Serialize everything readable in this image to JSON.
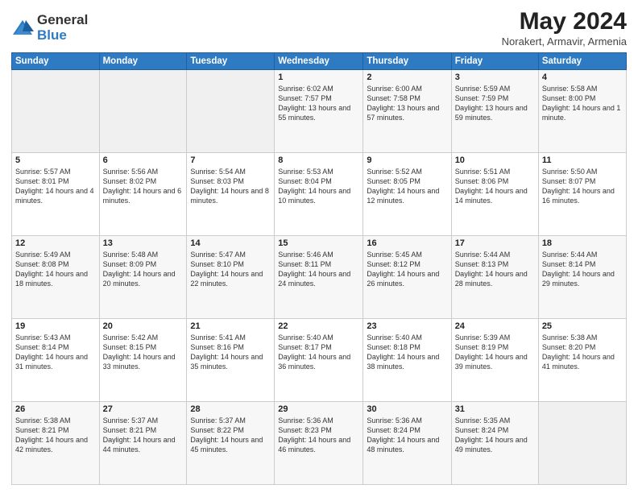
{
  "logo": {
    "general": "General",
    "blue": "Blue"
  },
  "title": "May 2024",
  "location": "Norakert, Armavir, Armenia",
  "headers": [
    "Sunday",
    "Monday",
    "Tuesday",
    "Wednesday",
    "Thursday",
    "Friday",
    "Saturday"
  ],
  "weeks": [
    [
      {
        "num": "",
        "detail": ""
      },
      {
        "num": "",
        "detail": ""
      },
      {
        "num": "",
        "detail": ""
      },
      {
        "num": "1",
        "detail": "Sunrise: 6:02 AM\nSunset: 7:57 PM\nDaylight: 13 hours\nand 55 minutes."
      },
      {
        "num": "2",
        "detail": "Sunrise: 6:00 AM\nSunset: 7:58 PM\nDaylight: 13 hours\nand 57 minutes."
      },
      {
        "num": "3",
        "detail": "Sunrise: 5:59 AM\nSunset: 7:59 PM\nDaylight: 13 hours\nand 59 minutes."
      },
      {
        "num": "4",
        "detail": "Sunrise: 5:58 AM\nSunset: 8:00 PM\nDaylight: 14 hours\nand 1 minute."
      }
    ],
    [
      {
        "num": "5",
        "detail": "Sunrise: 5:57 AM\nSunset: 8:01 PM\nDaylight: 14 hours\nand 4 minutes."
      },
      {
        "num": "6",
        "detail": "Sunrise: 5:56 AM\nSunset: 8:02 PM\nDaylight: 14 hours\nand 6 minutes."
      },
      {
        "num": "7",
        "detail": "Sunrise: 5:54 AM\nSunset: 8:03 PM\nDaylight: 14 hours\nand 8 minutes."
      },
      {
        "num": "8",
        "detail": "Sunrise: 5:53 AM\nSunset: 8:04 PM\nDaylight: 14 hours\nand 10 minutes."
      },
      {
        "num": "9",
        "detail": "Sunrise: 5:52 AM\nSunset: 8:05 PM\nDaylight: 14 hours\nand 12 minutes."
      },
      {
        "num": "10",
        "detail": "Sunrise: 5:51 AM\nSunset: 8:06 PM\nDaylight: 14 hours\nand 14 minutes."
      },
      {
        "num": "11",
        "detail": "Sunrise: 5:50 AM\nSunset: 8:07 PM\nDaylight: 14 hours\nand 16 minutes."
      }
    ],
    [
      {
        "num": "12",
        "detail": "Sunrise: 5:49 AM\nSunset: 8:08 PM\nDaylight: 14 hours\nand 18 minutes."
      },
      {
        "num": "13",
        "detail": "Sunrise: 5:48 AM\nSunset: 8:09 PM\nDaylight: 14 hours\nand 20 minutes."
      },
      {
        "num": "14",
        "detail": "Sunrise: 5:47 AM\nSunset: 8:10 PM\nDaylight: 14 hours\nand 22 minutes."
      },
      {
        "num": "15",
        "detail": "Sunrise: 5:46 AM\nSunset: 8:11 PM\nDaylight: 14 hours\nand 24 minutes."
      },
      {
        "num": "16",
        "detail": "Sunrise: 5:45 AM\nSunset: 8:12 PM\nDaylight: 14 hours\nand 26 minutes."
      },
      {
        "num": "17",
        "detail": "Sunrise: 5:44 AM\nSunset: 8:13 PM\nDaylight: 14 hours\nand 28 minutes."
      },
      {
        "num": "18",
        "detail": "Sunrise: 5:44 AM\nSunset: 8:14 PM\nDaylight: 14 hours\nand 29 minutes."
      }
    ],
    [
      {
        "num": "19",
        "detail": "Sunrise: 5:43 AM\nSunset: 8:14 PM\nDaylight: 14 hours\nand 31 minutes."
      },
      {
        "num": "20",
        "detail": "Sunrise: 5:42 AM\nSunset: 8:15 PM\nDaylight: 14 hours\nand 33 minutes."
      },
      {
        "num": "21",
        "detail": "Sunrise: 5:41 AM\nSunset: 8:16 PM\nDaylight: 14 hours\nand 35 minutes."
      },
      {
        "num": "22",
        "detail": "Sunrise: 5:40 AM\nSunset: 8:17 PM\nDaylight: 14 hours\nand 36 minutes."
      },
      {
        "num": "23",
        "detail": "Sunrise: 5:40 AM\nSunset: 8:18 PM\nDaylight: 14 hours\nand 38 minutes."
      },
      {
        "num": "24",
        "detail": "Sunrise: 5:39 AM\nSunset: 8:19 PM\nDaylight: 14 hours\nand 39 minutes."
      },
      {
        "num": "25",
        "detail": "Sunrise: 5:38 AM\nSunset: 8:20 PM\nDaylight: 14 hours\nand 41 minutes."
      }
    ],
    [
      {
        "num": "26",
        "detail": "Sunrise: 5:38 AM\nSunset: 8:21 PM\nDaylight: 14 hours\nand 42 minutes."
      },
      {
        "num": "27",
        "detail": "Sunrise: 5:37 AM\nSunset: 8:21 PM\nDaylight: 14 hours\nand 44 minutes."
      },
      {
        "num": "28",
        "detail": "Sunrise: 5:37 AM\nSunset: 8:22 PM\nDaylight: 14 hours\nand 45 minutes."
      },
      {
        "num": "29",
        "detail": "Sunrise: 5:36 AM\nSunset: 8:23 PM\nDaylight: 14 hours\nand 46 minutes."
      },
      {
        "num": "30",
        "detail": "Sunrise: 5:36 AM\nSunset: 8:24 PM\nDaylight: 14 hours\nand 48 minutes."
      },
      {
        "num": "31",
        "detail": "Sunrise: 5:35 AM\nSunset: 8:24 PM\nDaylight: 14 hours\nand 49 minutes."
      },
      {
        "num": "",
        "detail": ""
      }
    ]
  ]
}
